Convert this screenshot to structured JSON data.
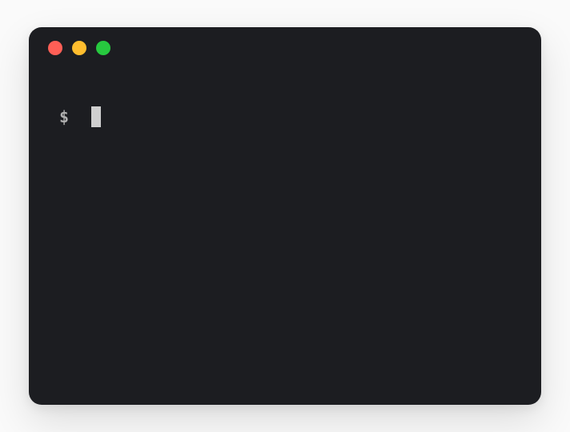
{
  "terminal": {
    "prompt_symbol": "$",
    "command_input": ""
  },
  "window_controls": {
    "close_color": "#ff5f56",
    "minimize_color": "#ffbd2e",
    "maximize_color": "#27c93f"
  }
}
